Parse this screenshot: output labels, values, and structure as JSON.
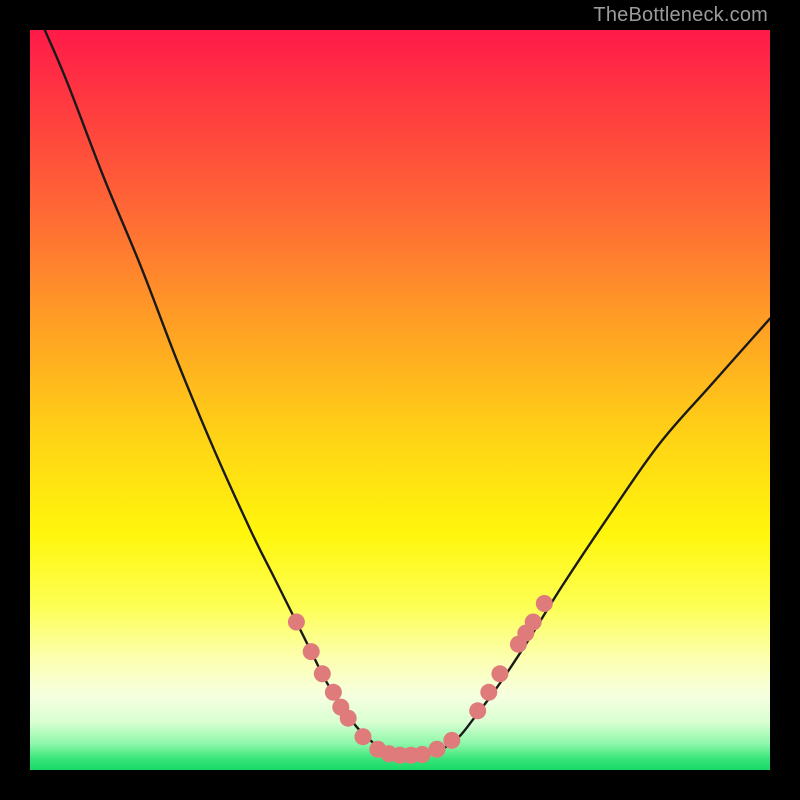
{
  "watermark": "TheBottleneck.com",
  "colors": {
    "frame": "#000000",
    "curve": "#1a1a1a",
    "marker_fill": "#e07b7b",
    "marker_stroke": "#d66a6a",
    "gradient_stops": [
      {
        "offset": 0.0,
        "color": "#ff1a49"
      },
      {
        "offset": 0.1,
        "color": "#ff3a40"
      },
      {
        "offset": 0.25,
        "color": "#ff6a35"
      },
      {
        "offset": 0.4,
        "color": "#ffa024"
      },
      {
        "offset": 0.55,
        "color": "#ffd316"
      },
      {
        "offset": 0.68,
        "color": "#fff60c"
      },
      {
        "offset": 0.78,
        "color": "#fdff55"
      },
      {
        "offset": 0.85,
        "color": "#fcffb0"
      },
      {
        "offset": 0.9,
        "color": "#f6ffe0"
      },
      {
        "offset": 0.935,
        "color": "#d9ffd2"
      },
      {
        "offset": 0.965,
        "color": "#8cf7a8"
      },
      {
        "offset": 0.985,
        "color": "#38e57a"
      },
      {
        "offset": 1.0,
        "color": "#17d968"
      }
    ]
  },
  "chart_data": {
    "type": "line",
    "title": "",
    "xlabel": "",
    "ylabel": "",
    "xlim": [
      0,
      100
    ],
    "ylim": [
      0,
      100
    ],
    "grid": false,
    "legend": false,
    "series": [
      {
        "name": "bottleneck-curve",
        "x": [
          2,
          5,
          10,
          15,
          20,
          25,
          30,
          33,
          36,
          38,
          40,
          42,
          44,
          46,
          48,
          50,
          52,
          54,
          56,
          58,
          60,
          63,
          67,
          72,
          78,
          85,
          92,
          100
        ],
        "y": [
          100,
          93,
          80,
          68,
          55,
          43,
          32,
          26,
          20,
          16,
          12,
          9,
          6,
          4,
          2.5,
          2,
          2,
          2.3,
          3,
          4.5,
          7,
          11,
          17,
          25,
          34,
          44,
          52,
          61
        ]
      }
    ],
    "markers": [
      {
        "x": 36.0,
        "y": 20.0
      },
      {
        "x": 38.0,
        "y": 16.0
      },
      {
        "x": 39.5,
        "y": 13.0
      },
      {
        "x": 41.0,
        "y": 10.5
      },
      {
        "x": 42.0,
        "y": 8.5
      },
      {
        "x": 43.0,
        "y": 7.0
      },
      {
        "x": 45.0,
        "y": 4.5
      },
      {
        "x": 47.0,
        "y": 2.8
      },
      {
        "x": 48.5,
        "y": 2.2
      },
      {
        "x": 50.0,
        "y": 2.0
      },
      {
        "x": 51.5,
        "y": 2.0
      },
      {
        "x": 53.0,
        "y": 2.1
      },
      {
        "x": 55.0,
        "y": 2.8
      },
      {
        "x": 57.0,
        "y": 4.0
      },
      {
        "x": 60.5,
        "y": 8.0
      },
      {
        "x": 62.0,
        "y": 10.5
      },
      {
        "x": 63.5,
        "y": 13.0
      },
      {
        "x": 66.0,
        "y": 17.0
      },
      {
        "x": 67.0,
        "y": 18.5
      },
      {
        "x": 68.0,
        "y": 20.0
      },
      {
        "x": 69.5,
        "y": 22.5
      }
    ]
  }
}
